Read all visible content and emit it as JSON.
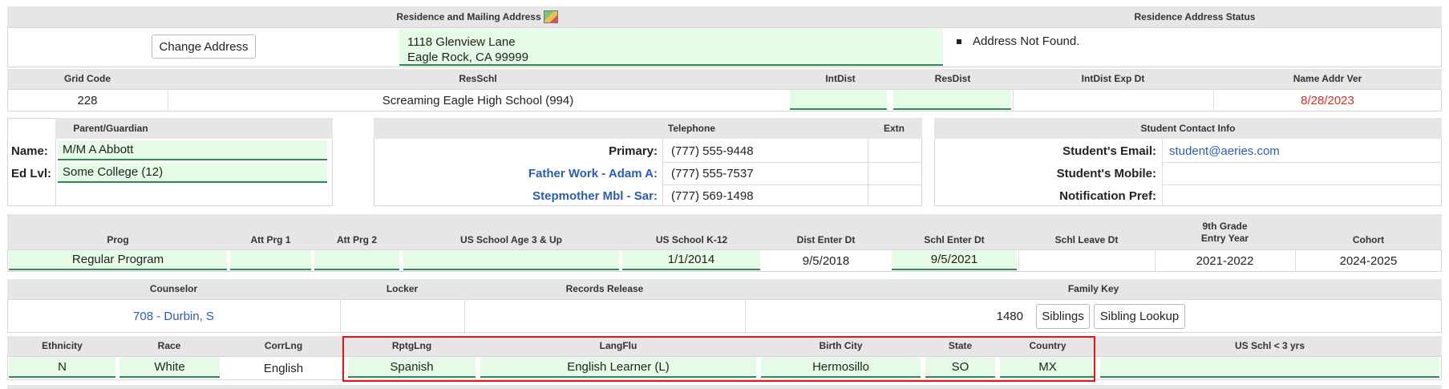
{
  "address": {
    "header": "Residence and Mailing Address",
    "status_header": "Residence Address Status",
    "change_button": "Change Address",
    "line1": "1118 Glenview Lane",
    "line2": "Eagle Rock, CA 99999",
    "status": "Address Not Found."
  },
  "grid": {
    "headers": [
      "Grid Code",
      "ResSchl",
      "IntDist",
      "ResDist",
      "IntDist Exp Dt",
      "Name Addr Ver"
    ],
    "grid_code": "228",
    "res_schl": "Screaming Eagle High School (994)",
    "int_dist": "",
    "res_dist": "",
    "int_dist_exp": "",
    "name_addr_ver": "8/28/2023"
  },
  "parent": {
    "header": "Parent/Guardian",
    "name_label": "Name:",
    "name_value": "M/M A Abbott",
    "edlvl_label": "Ed Lvl:",
    "edlvl_value": "Some College (12)"
  },
  "telephone": {
    "header": "Telephone",
    "extn_header": "Extn",
    "rows": [
      {
        "label": "Primary:",
        "value": "(777) 555-9448"
      },
      {
        "label": "Father Work - Adam A:",
        "value": "(777) 555-7537"
      },
      {
        "label": "Stepmother Mbl - Sar:",
        "value": "(777) 569-1498"
      }
    ]
  },
  "contact": {
    "header": "Student Contact Info",
    "email_label": "Student's Email:",
    "email_value": "student@aeries.com",
    "mobile_label": "Student's Mobile:",
    "notif_label": "Notification Pref:"
  },
  "program": {
    "headers": [
      "Prog",
      "Att Prg 1",
      "Att Prg 2",
      "US School Age 3 & Up",
      "US School K-12",
      "Dist Enter Dt",
      "Schl Enter Dt",
      "Schl Leave Dt",
      "9th Grade",
      "Entry Year",
      "Cohort"
    ],
    "prog": "Regular Program",
    "us_k12": "1/1/2014",
    "dist_enter": "9/5/2018",
    "schl_enter": "9/5/2021",
    "entry_year": "2021-2022",
    "cohort": "2024-2025"
  },
  "counselor": {
    "headers": [
      "Counselor",
      "Locker",
      "Records Release",
      "Family Key"
    ],
    "counselor": "708 - Durbin, S",
    "family_key": "1480",
    "siblings_button": "Siblings",
    "sibling_lookup_button": "Sibling Lookup"
  },
  "ethnicity": {
    "headers": [
      "Ethnicity",
      "Race",
      "CorrLng",
      "RptgLng",
      "LangFlu",
      "Birth City",
      "State",
      "Country",
      "US Schl < 3 yrs"
    ],
    "ethnicity": "N",
    "race": "White",
    "corrlng": "English",
    "rptglng": "Spanish",
    "langflu": "English Learner (L)",
    "birth_city": "Hermosillo",
    "state": "SO",
    "country": "MX"
  },
  "colors": {
    "accent": "#2e8b57",
    "link": "#2a5db0",
    "alert": "#e0281e",
    "field_bg": "#e6fbe6",
    "highlight": "#ee1111"
  }
}
